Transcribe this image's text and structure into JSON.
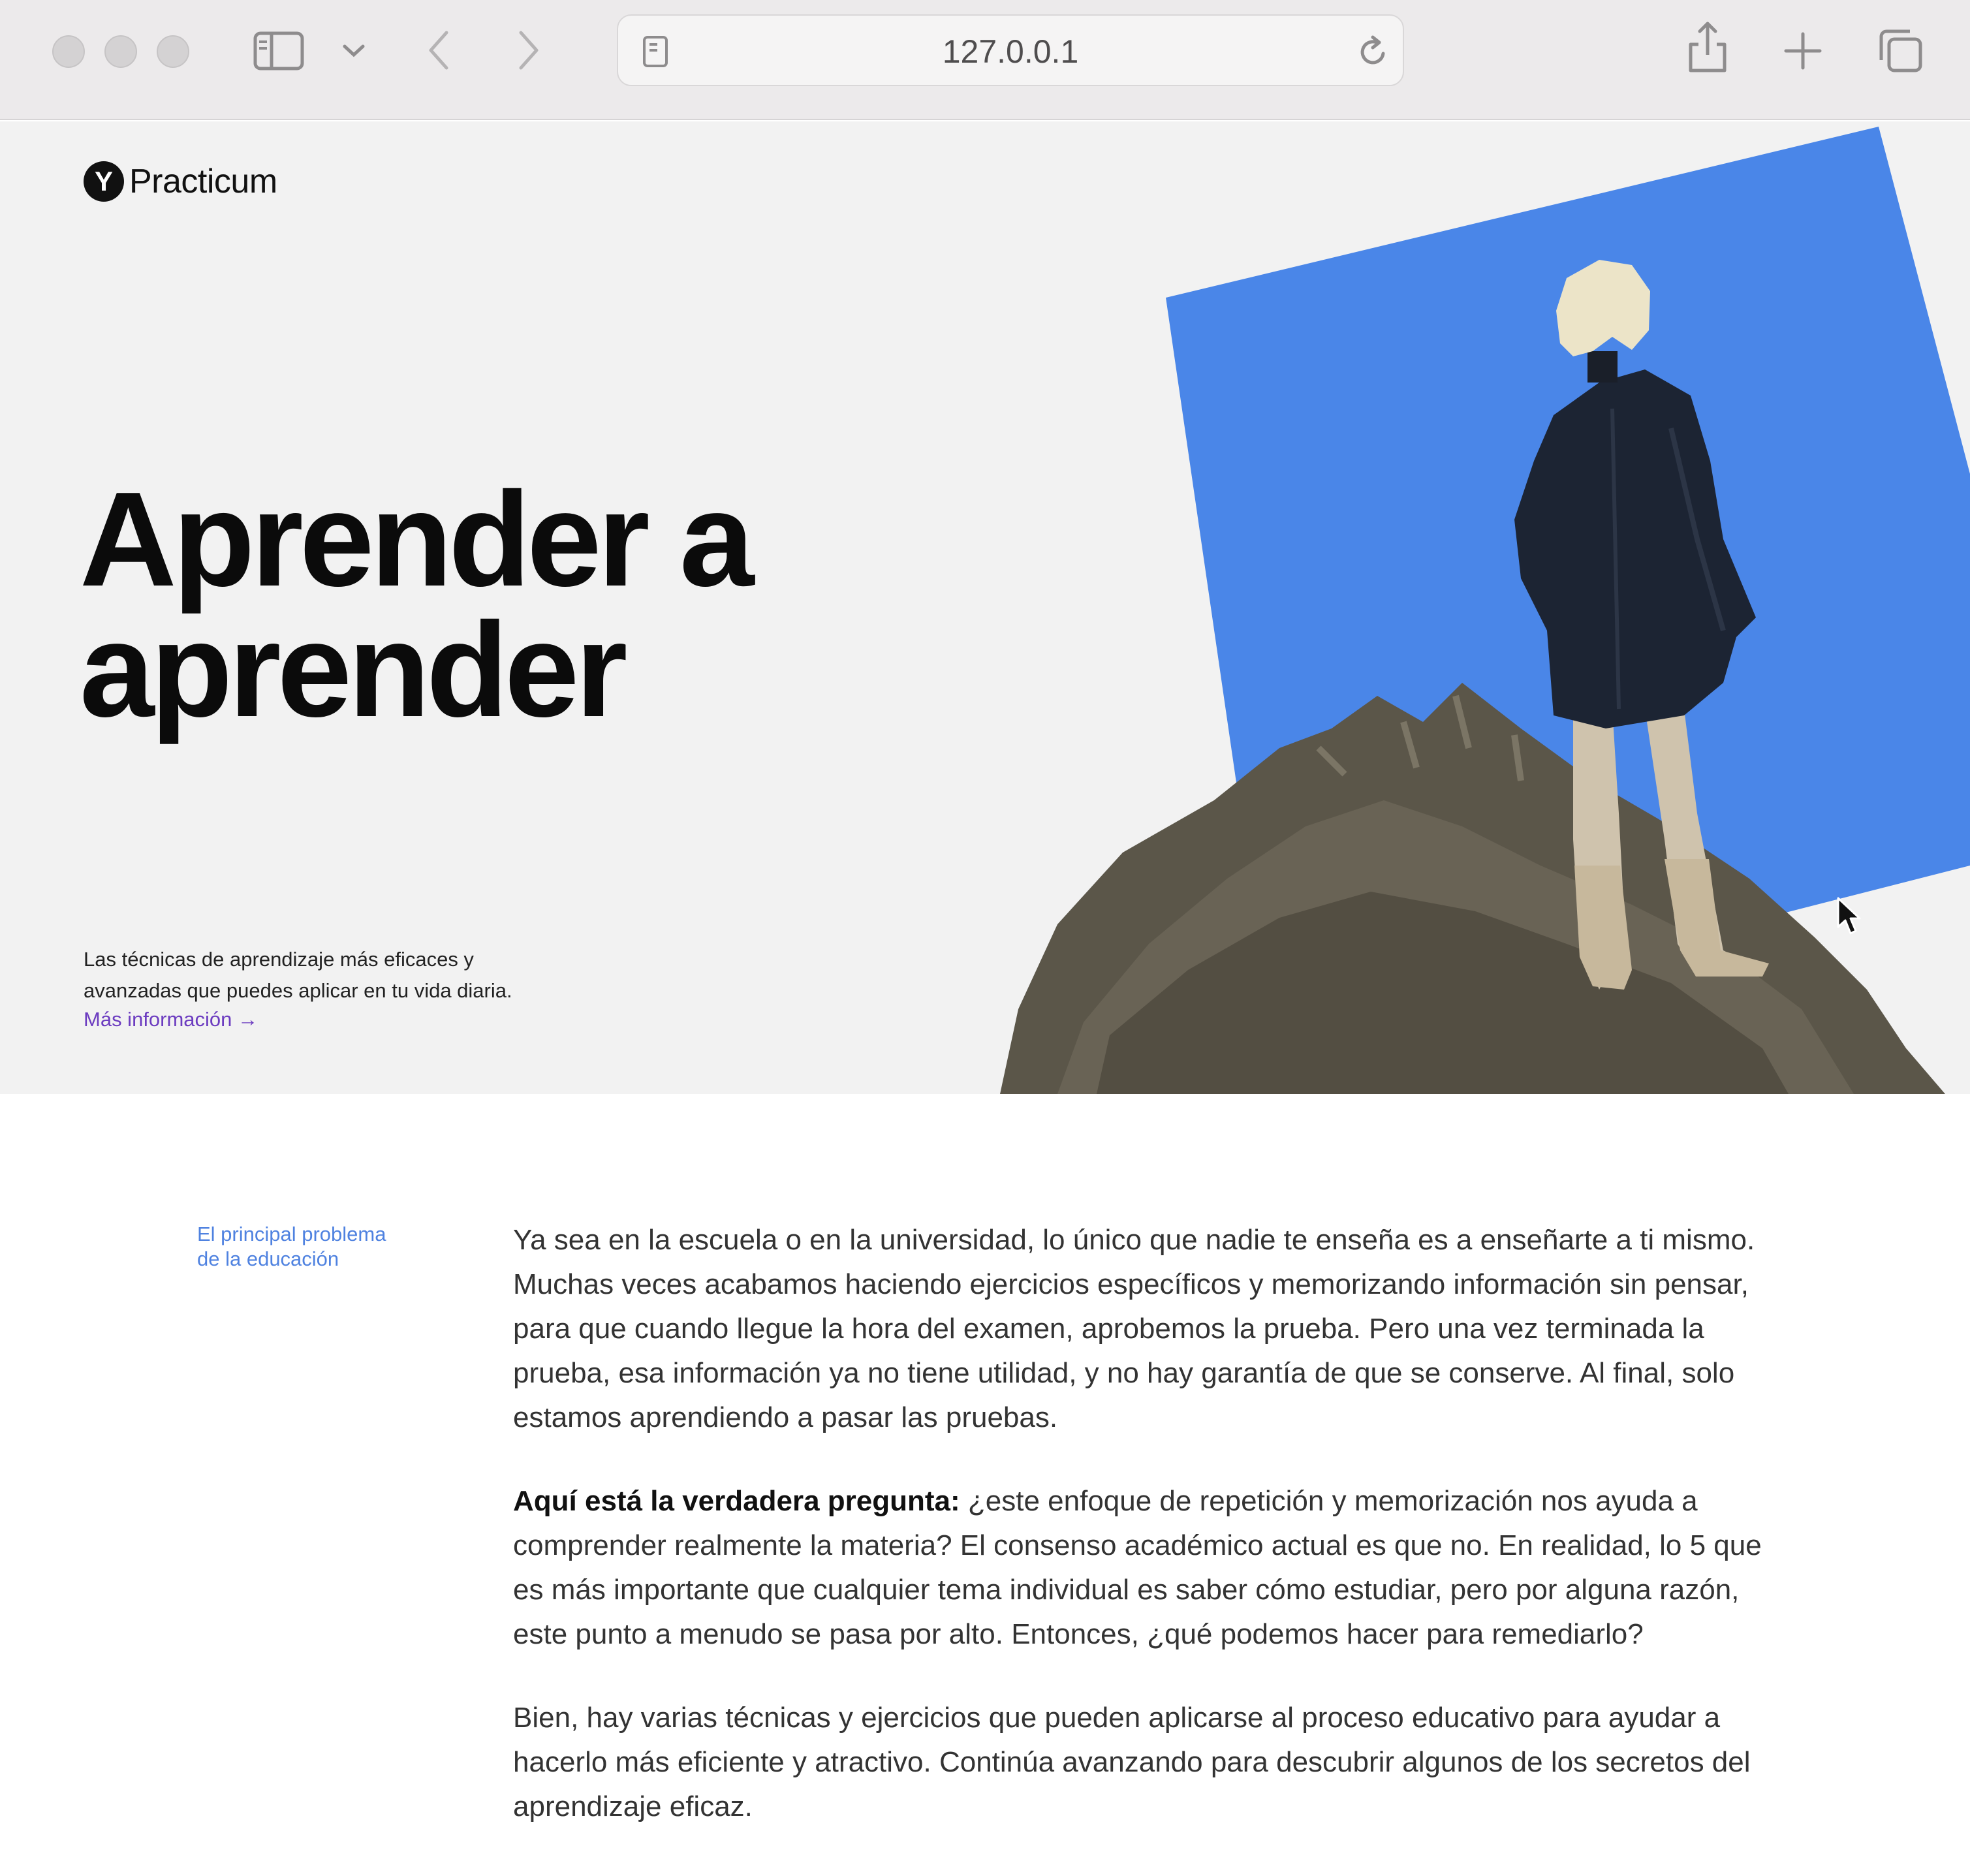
{
  "browser": {
    "url": "127.0.0.1",
    "icons": [
      "sidebar-icon",
      "chevron-down-icon",
      "back-icon",
      "forward-icon",
      "page-icon",
      "reload-icon",
      "share-icon",
      "new-tab-icon",
      "tabs-overview-icon"
    ]
  },
  "hero": {
    "logo_mark": "Y",
    "logo_text": "Practicum",
    "title_line1": "Aprender a",
    "title_line2": "aprender",
    "description_line1": "Las técnicas de aprendizaje más eficaces y",
    "description_line2": "avanzadas que puedes aplicar en tu vida diaria.",
    "more_link": "Más información →",
    "accent_color": "#4a86e8"
  },
  "article": {
    "side_label_line1": "El principal problema",
    "side_label_line2": "de la educación",
    "paragraph1": "Ya sea en la escuela o en la universidad, lo único que nadie te enseña es a enseñarte a ti mismo. Muchas veces acabamos haciendo ejercicios específicos y memorizando información sin pensar, para que cuando llegue la hora del examen, aprobemos la prueba. Pero una vez terminada la prueba, esa información ya no tiene utilidad, y no hay garantía de que se conserve. Al final, solo estamos aprendiendo a pasar las pruebas.",
    "paragraph2_bold": "Aquí está la verdadera pregunta:",
    "paragraph2_rest": " ¿este enfoque de repetición y memorización nos ayuda a comprender realmente la materia? El consenso académico actual es que no. En realidad, lo 5 que es más importante que cualquier tema individual es saber cómo estudiar, pero por alguna razón, este punto a menudo se pasa por alto. Entonces, ¿qué podemos hacer para remediarlo?",
    "paragraph3": "Bien, hay varias técnicas y ejercicios que pueden aplicarse al proceso educativo para ayudar a hacerlo más eficiente y atractivo. Continúa avanzando para descubrir algunos de los secretos del aprendizaje eficaz."
  }
}
